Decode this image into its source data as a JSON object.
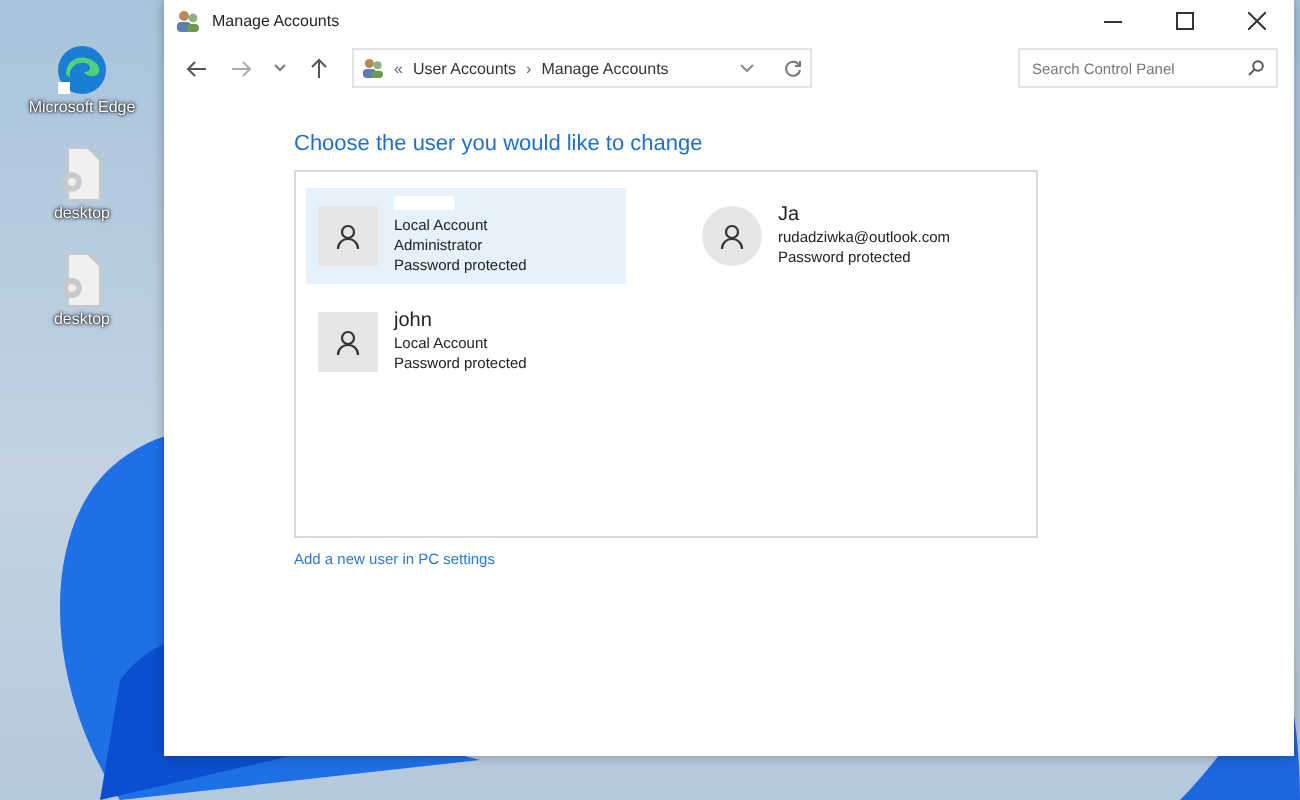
{
  "desktop_icons": [
    {
      "label": "Microsoft Edge",
      "kind": "browser"
    },
    {
      "label": "desktop",
      "kind": "settings-file"
    },
    {
      "label": "desktop",
      "kind": "settings-file"
    }
  ],
  "window": {
    "title": "Manage Accounts"
  },
  "address_bar": {
    "breadcrumb_prefix": "«",
    "crumbs": [
      "User Accounts",
      "Manage Accounts"
    ],
    "separator": "›"
  },
  "search": {
    "placeholder": "Search Control Panel"
  },
  "heading": "Choose the user you would like to change",
  "accounts": [
    {
      "name_hidden": true,
      "round_avatar": false,
      "selected": true,
      "details": [
        "Local Account",
        "Administrator",
        "Password protected"
      ]
    },
    {
      "name": "Ja",
      "round_avatar": true,
      "selected": false,
      "details": [
        "rudadziwka@outlook.com",
        "Password protected"
      ]
    },
    {
      "name": "john",
      "round_avatar": false,
      "selected": false,
      "details": [
        "Local Account",
        "Password protected"
      ]
    }
  ],
  "link": "Add a new user in PC settings"
}
